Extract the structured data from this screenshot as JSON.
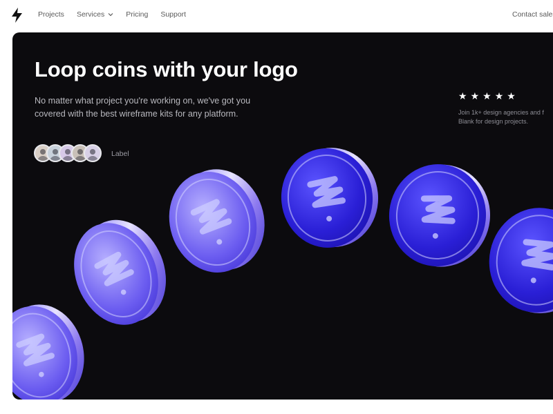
{
  "nav": {
    "logo_icon": "lightning-bolt-icon",
    "items": [
      "Projects",
      "Services",
      "Pricing",
      "Support"
    ],
    "services_icon": "chevron-down-icon",
    "contact_label": "Contact sales"
  },
  "hero": {
    "title": "Loop coins with your logo",
    "description": "No matter what project you're working on, we've got you covered with the best wireframe kits for any platform.",
    "avatar_label": "Label",
    "avatar_colors": [
      "#d9cfc6",
      "#c8d2dc",
      "#d7c9e8",
      "#c9c0b8",
      "#d8d0e6"
    ],
    "rating_stars": 5,
    "rating_line1": "Join 1k+ design agencies and f",
    "rating_line2": "Blank for design projects.",
    "background_color": "#0c0b0e",
    "coin_color": "#2a1fd6"
  }
}
